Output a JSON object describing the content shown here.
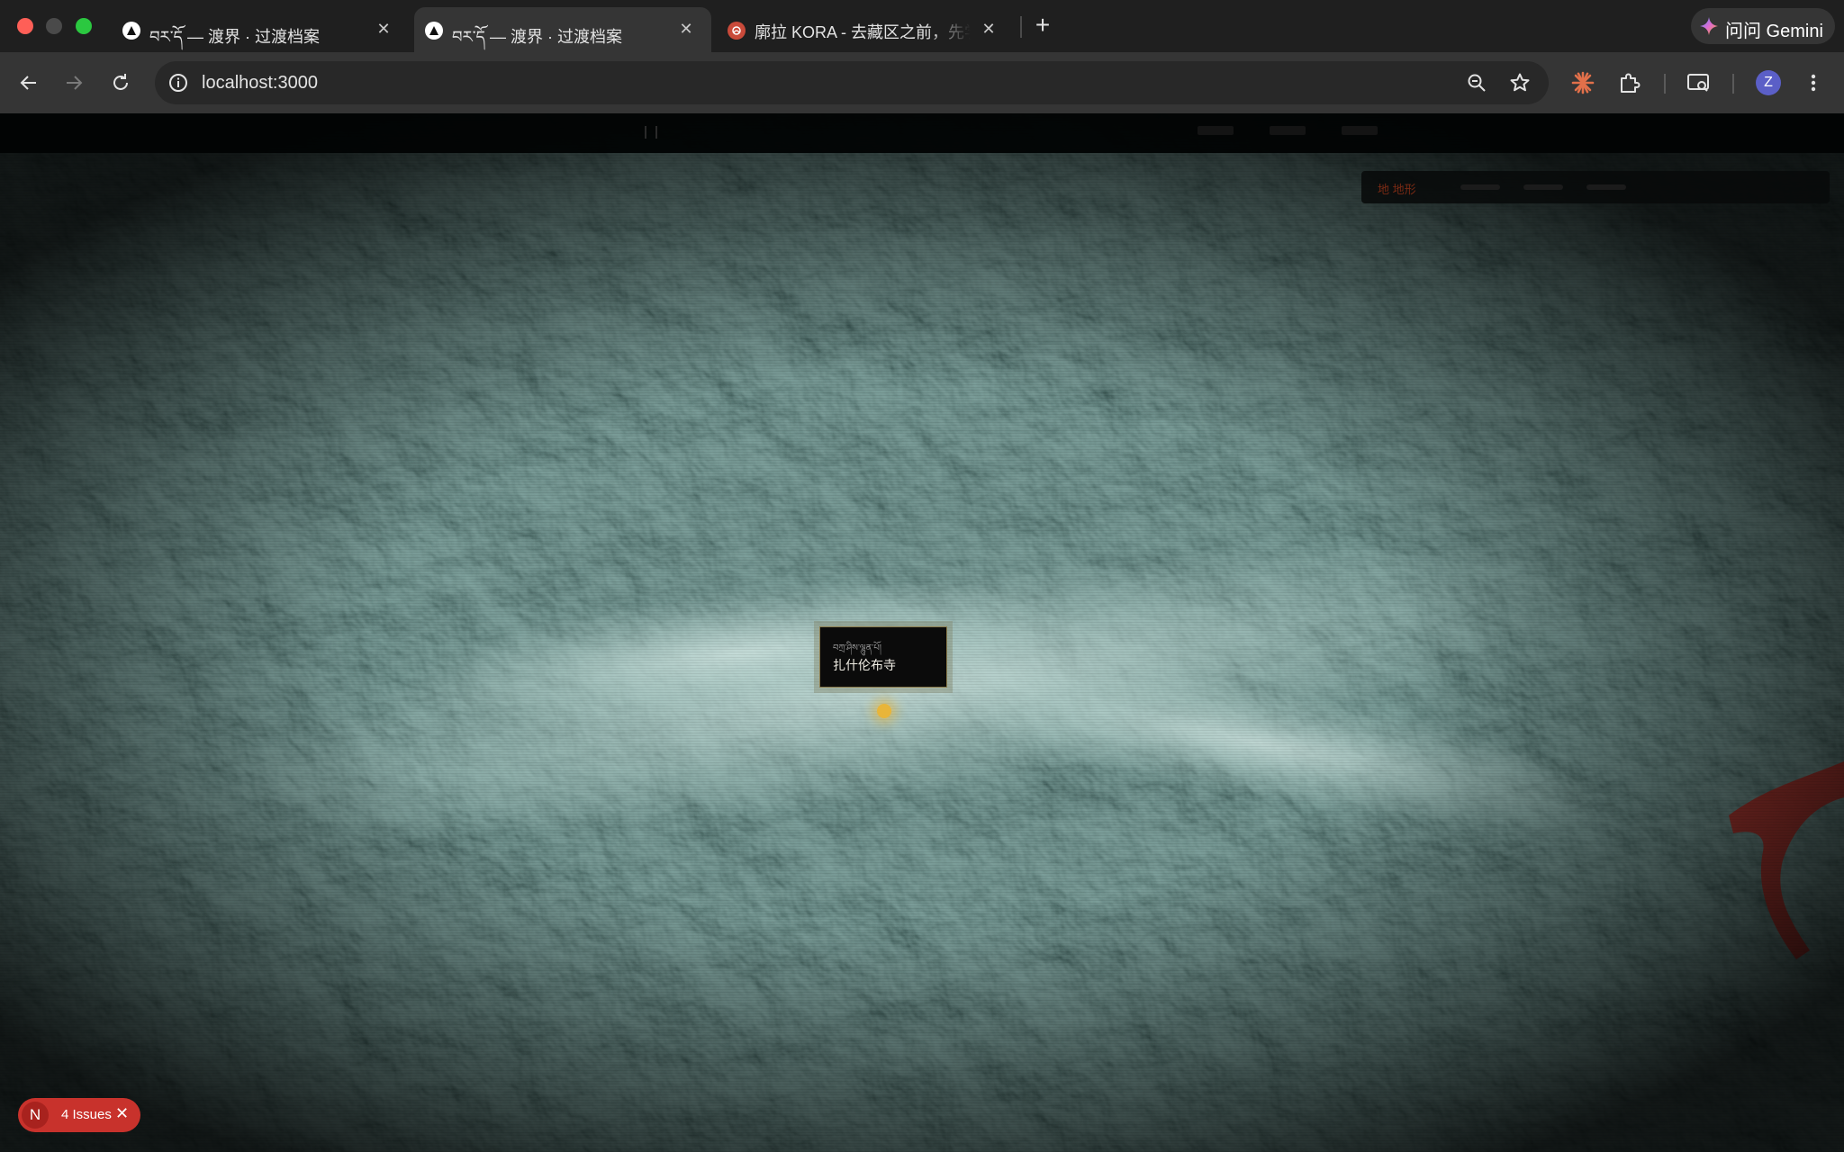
{
  "browser": {
    "tabs": [
      {
        "title": "བར་དོ — 渡界 · 过渡档案",
        "active": false
      },
      {
        "title": "བར་དོ — 渡界 · 过渡档案",
        "active": true
      },
      {
        "title": "廓拉 KORA - 去藏区之前，先学",
        "active": false
      }
    ],
    "new_tab_label": "+",
    "gemini_label": "问问 Gemini",
    "url": "localhost:3000",
    "avatar_letter": "Z"
  },
  "map": {
    "tooltip": {
      "tibetan": "བཀྲ་ཤིས་ལྷུན་པོ།",
      "name": "扎什伦布寺"
    },
    "layer_label": "地 地形"
  },
  "devtools": {
    "badge_letter": "N",
    "issues_label": "4 Issues",
    "close_glyph": "✕"
  },
  "colors": {
    "accent_marker": "#e8b53a",
    "issues_red": "#c8322c",
    "terrain_base": "#2c4a47"
  }
}
